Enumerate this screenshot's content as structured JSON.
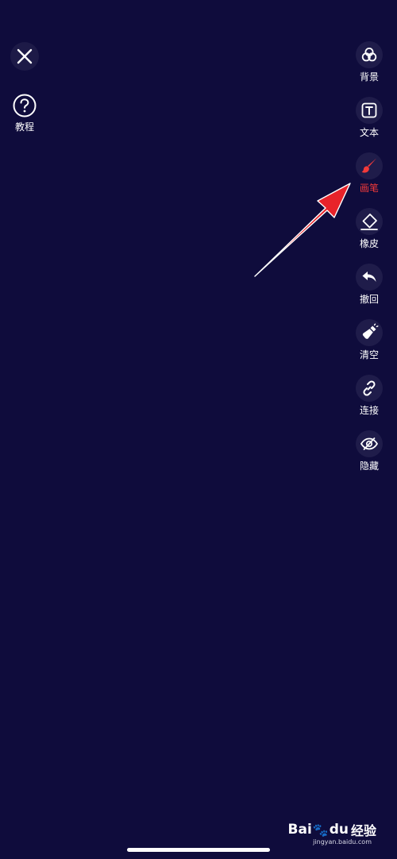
{
  "header": {
    "close_icon": "close-icon",
    "tutorial": {
      "icon": "help-circle-icon",
      "label": "教程"
    }
  },
  "toolbar": {
    "active_color": "#f23a3a",
    "items": [
      {
        "icon": "layers-icon",
        "label": "背景",
        "active": false
      },
      {
        "icon": "text-box-icon",
        "label": "文本",
        "active": false
      },
      {
        "icon": "brush-icon",
        "label": "画笔",
        "active": true
      },
      {
        "icon": "eraser-icon",
        "label": "橡皮",
        "active": false
      },
      {
        "icon": "undo-icon",
        "label": "撤回",
        "active": false
      },
      {
        "icon": "clear-broom-icon",
        "label": "清空",
        "active": false
      },
      {
        "icon": "link-icon",
        "label": "连接",
        "active": false
      },
      {
        "icon": "eye-off-icon",
        "label": "隐藏",
        "active": false
      }
    ]
  },
  "colors": {
    "background": "#0f0c3c",
    "button_bg": "#1f1c4a",
    "annotation_arrow": "#e8232a"
  },
  "watermark": {
    "brand_a": "Bai",
    "brand_b": "du",
    "brand_c": "经验",
    "url": "jingyan.baidu.com"
  }
}
